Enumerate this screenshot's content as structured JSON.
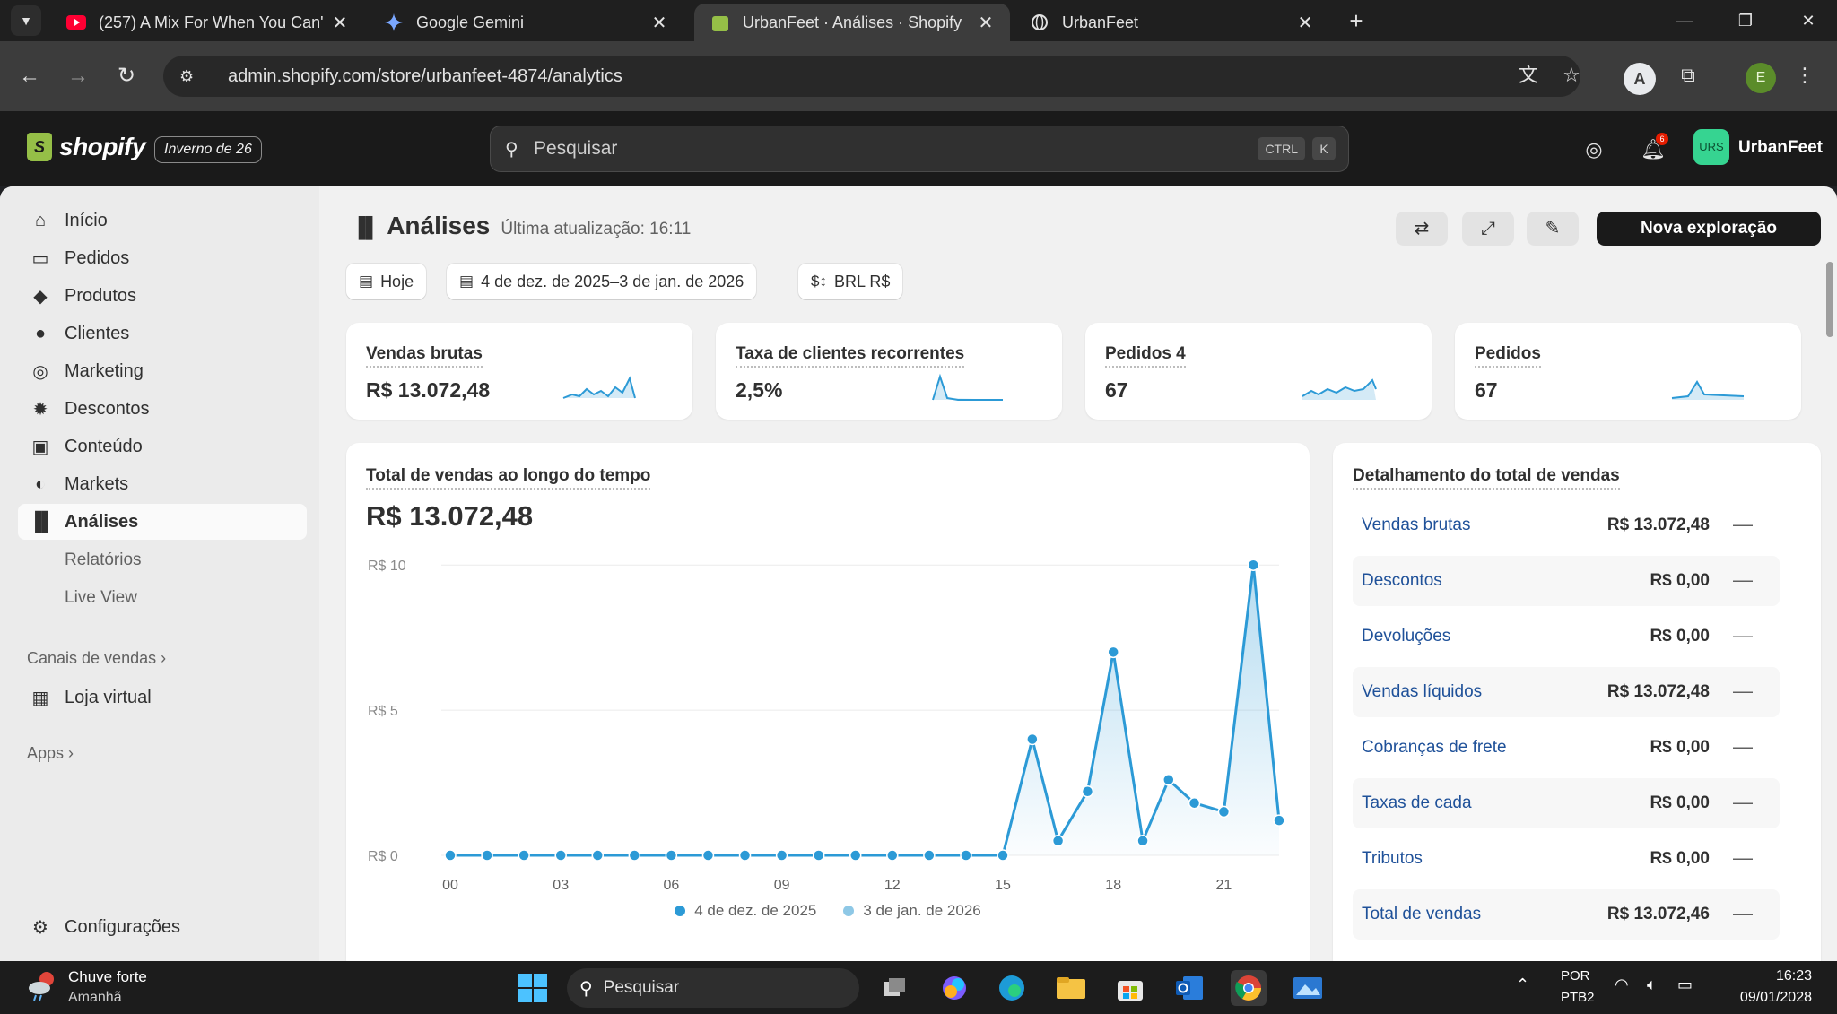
{
  "browser": {
    "tabs": [
      {
        "title": "(257) A Mix For When You Can't",
        "favicon": "youtube-icon",
        "active": false
      },
      {
        "title": "Google Gemini",
        "favicon": "gemini-icon",
        "active": false
      },
      {
        "title": "UrbanFeet · Análises · Shopify",
        "favicon": "shopify-icon",
        "active": true
      },
      {
        "title": "UrbanFeet",
        "favicon": "globe-icon",
        "active": false
      }
    ],
    "url": "admin.shopify.com/store/urbanfeet-4874/analytics",
    "profile_initial": "E"
  },
  "shopify": {
    "logo_text": "shopify",
    "edition": "Inverno de 26",
    "search_placeholder": "Pesquisar",
    "shortcut": "CTRL",
    "shortcut_key": "K",
    "notification_count": "6",
    "store_badge": "URS",
    "store_name": "UrbanFeet"
  },
  "sidebar": {
    "items": [
      {
        "label": "Início",
        "icon": "home-icon"
      },
      {
        "label": "Pedidos",
        "icon": "inbox-icon"
      },
      {
        "label": "Produtos",
        "icon": "tag-icon"
      },
      {
        "label": "Clientes",
        "icon": "person-icon"
      },
      {
        "label": "Marketing",
        "icon": "target-icon"
      },
      {
        "label": "Descontos",
        "icon": "discount-icon"
      },
      {
        "label": "Conteúdo",
        "icon": "content-icon"
      },
      {
        "label": "Markets",
        "icon": "globe-icon"
      },
      {
        "label": "Análises",
        "icon": "bar-chart-icon",
        "active": true
      }
    ],
    "sub_items": [
      "Relatórios",
      "Live View"
    ],
    "sales_channels_label": "Canais de vendas",
    "online_store_label": "Loja virtual",
    "apps_label": "Apps",
    "settings_label": "Configurações"
  },
  "page": {
    "title": "Análises",
    "last_update": "Última atualização: 16:11",
    "new_exploration": "Nova exploração",
    "filters": {
      "today": "Hoje",
      "date_range": "4 de dez. de 2025–3 de jan. de 2026",
      "currency": "BRL R$"
    }
  },
  "kpis": [
    {
      "label": "Vendas brutas",
      "value": "R$ 13.072,48"
    },
    {
      "label": "Taxa de clientes recorrentes",
      "value": "2,5%"
    },
    {
      "label": "Pedidos 4",
      "value": "67"
    },
    {
      "label": "Pedidos",
      "value": "67"
    }
  ],
  "sales_chart": {
    "title": "Total de vendas ao longo do tempo",
    "total": "R$ 13.072,48"
  },
  "chart_data": {
    "type": "line",
    "title": "Total de vendas ao longo do tempo",
    "xlabel": "",
    "ylabel": "",
    "x": [
      0,
      1,
      2,
      3,
      4,
      5,
      6,
      7,
      8,
      9,
      10,
      11,
      12,
      13,
      14,
      15,
      16,
      17,
      18,
      19,
      20,
      21,
      22,
      23
    ],
    "x_tick_labels": [
      "00",
      "03",
      "06",
      "09",
      "12",
      "15",
      "18",
      "21"
    ],
    "x_tick_values": [
      0,
      3,
      6,
      9,
      12,
      15,
      18,
      21
    ],
    "y_tick_labels": [
      "R$ 0",
      "R$ 5",
      "R$ 10"
    ],
    "y_tick_values": [
      0,
      5,
      10
    ],
    "ylim": [
      0,
      10.5
    ],
    "grid": true,
    "legend": "bottom",
    "series": [
      {
        "name": "4 de dez. de 2025",
        "color": "#2c9ad6",
        "values": [
          0,
          0,
          0,
          0,
          0,
          0,
          0,
          0,
          0,
          0,
          0,
          0,
          0,
          0,
          0,
          0,
          4.0,
          0.5,
          2.2,
          7.0,
          0.5,
          2.6,
          1.8,
          1.5,
          10.0,
          1.2
        ],
        "x": [
          0,
          1,
          2,
          3,
          4,
          5,
          6,
          7,
          8,
          9,
          10,
          11,
          12,
          13,
          14,
          15,
          15.8,
          16.5,
          17.3,
          18,
          18.8,
          19.5,
          20.2,
          21,
          21.8,
          22.5
        ]
      },
      {
        "name": "3 de jan. de 2026",
        "color": "#8ec8e6",
        "values": [],
        "x": []
      }
    ]
  },
  "breakdown": {
    "title": "Detalhamento do total de vendas",
    "rows": [
      {
        "label": "Vendas brutas",
        "value": "R$ 13.072,48"
      },
      {
        "label": "Descontos",
        "value": "R$ 0,00"
      },
      {
        "label": "Devoluções",
        "value": "R$ 0,00"
      },
      {
        "label": "Vendas líquidos",
        "value": "R$ 13.072,48"
      },
      {
        "label": "Cobranças de frete",
        "value": "R$ 0,00"
      },
      {
        "label": "Taxas de cada",
        "value": "R$ 0,00"
      },
      {
        "label": "Tributos",
        "value": "R$ 0,00"
      },
      {
        "label": "Total de vendas",
        "value": "R$ 13.072,46"
      }
    ]
  },
  "taskbar": {
    "weather_line1": "Chuve forte",
    "weather_line2": "Amanhã",
    "search_label": "Pesquisar",
    "lang1": "POR",
    "lang2": "PTB2",
    "time": "16:23",
    "date": "09/01/2028"
  }
}
